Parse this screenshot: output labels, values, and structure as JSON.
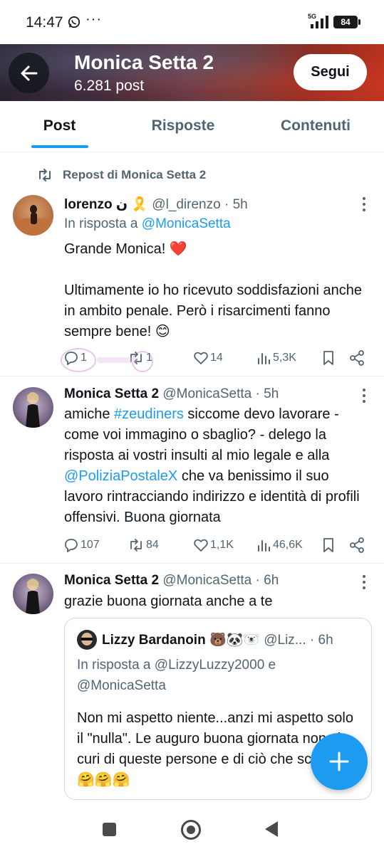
{
  "status_bar": {
    "time": "14:47",
    "network": "5G",
    "battery": "84"
  },
  "header": {
    "name": "Monica Setta 2",
    "post_count": "6.281 post",
    "follow_label": "Segui"
  },
  "tabs": [
    {
      "label": "Post",
      "active": true
    },
    {
      "label": "Risposte",
      "active": false
    },
    {
      "label": "Contenuti",
      "active": false
    }
  ],
  "repost_label": "Repost di Monica Setta 2",
  "tweets": [
    {
      "name": "lorenzo",
      "name_suffix": "ن 🎗️",
      "handle": "@l_direnzo",
      "time": "· 5h",
      "reply_prefix": "In risposta a ",
      "reply_to": "@MonicaSetta",
      "text_line1": "Grande Monica! ❤️",
      "text_line2": "Ultimamente io ho ricevuto soddisfazioni anche in ambito penale. Però i risarcimenti fanno sempre bene! 😊",
      "replies": "1",
      "reposts": "1",
      "likes": "14",
      "views": "5,3K"
    },
    {
      "name": "Monica Setta 2",
      "handle": "@MonicaSetta",
      "time": "· 5h",
      "text_a": "amiche ",
      "hashtag": "#zeudiners",
      "text_b": " siccome devo lavorare - come voi immagino o sbaglio? - delego la risposta ai vostri insulti al mio legale e alla ",
      "mention": "@PoliziaPostaleX",
      "text_c": " che va benissimo il suo lavoro rintracciando indirizzo e identità di profili offensivi. Buona giornata",
      "replies": "107",
      "reposts": "84",
      "likes": "1,1K",
      "views": "46,6K"
    },
    {
      "name": "Monica Setta 2",
      "handle": "@MonicaSetta",
      "time": "· 6h",
      "text": "grazie buona giornata anche a te"
    }
  ],
  "quote": {
    "name": "Lizzy Bardanoin 🐻🐼🐻‍❄️",
    "handle": "@Liz...",
    "time": "· 6h",
    "reply_prefix": "In risposta a ",
    "reply_to_1": "@LizzyLuzzy2000",
    "reply_join": " e",
    "reply_to_2": "@MonicaSetta",
    "text": "Non mi aspetto niente...anzi mi aspetto solo il \"nulla\". Le auguro buona giornata non si curi di queste persone e di ciò che scrivono 🤗🤗🤗"
  },
  "colors": {
    "accent": "#1d9bf0",
    "secondary_text": "#536471",
    "primary_text": "#0f1419"
  },
  "icons": [
    "back-arrow-icon",
    "more-icon",
    "repost-icon",
    "reply-icon",
    "retweet-icon",
    "like-icon",
    "views-icon",
    "bookmark-icon",
    "share-icon",
    "compose-plus-icon"
  ]
}
